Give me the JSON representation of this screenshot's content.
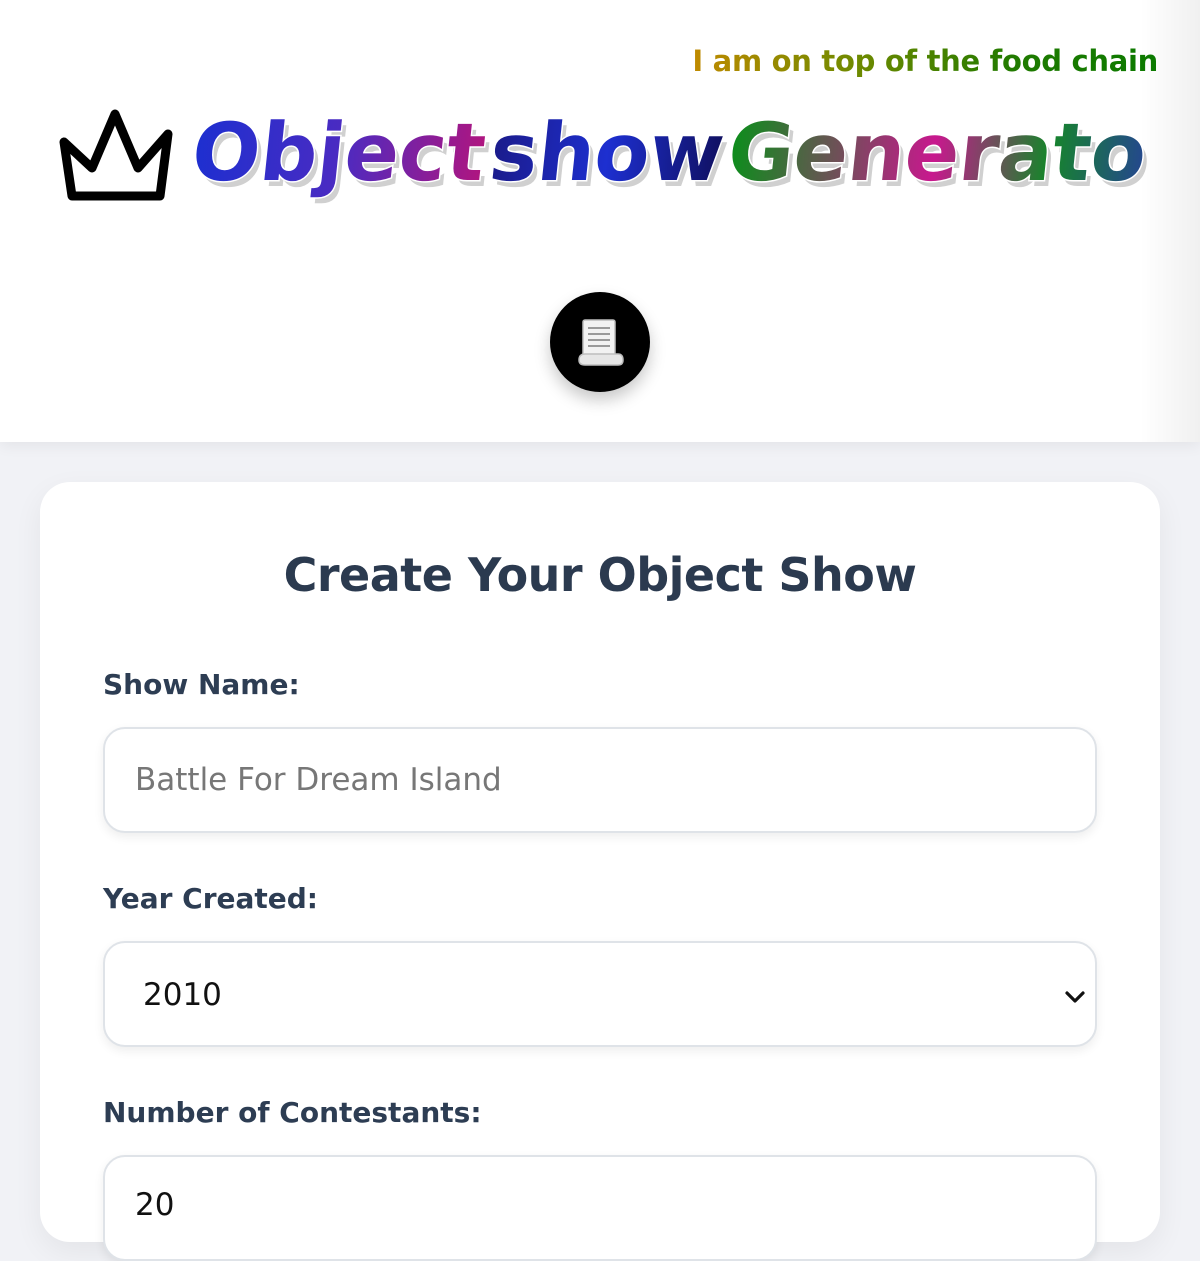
{
  "header": {
    "tagline": "I am on top of the food chain",
    "logo_icon": "crown-icon",
    "title_words": [
      "Object",
      "show",
      "Generator"
    ],
    "title_colors": [
      "#2438c9",
      "#c8188e",
      "#1f8f23"
    ],
    "menu_button_icon": "scroll-icon"
  },
  "form": {
    "heading": "Create Your Object Show",
    "show_name": {
      "label": "Show Name:",
      "placeholder": "Battle For Dream Island",
      "value": ""
    },
    "year_created": {
      "label": "Year Created:",
      "selected": "2010"
    },
    "contestants": {
      "label": "Number of Contestants:",
      "value": "20"
    }
  }
}
